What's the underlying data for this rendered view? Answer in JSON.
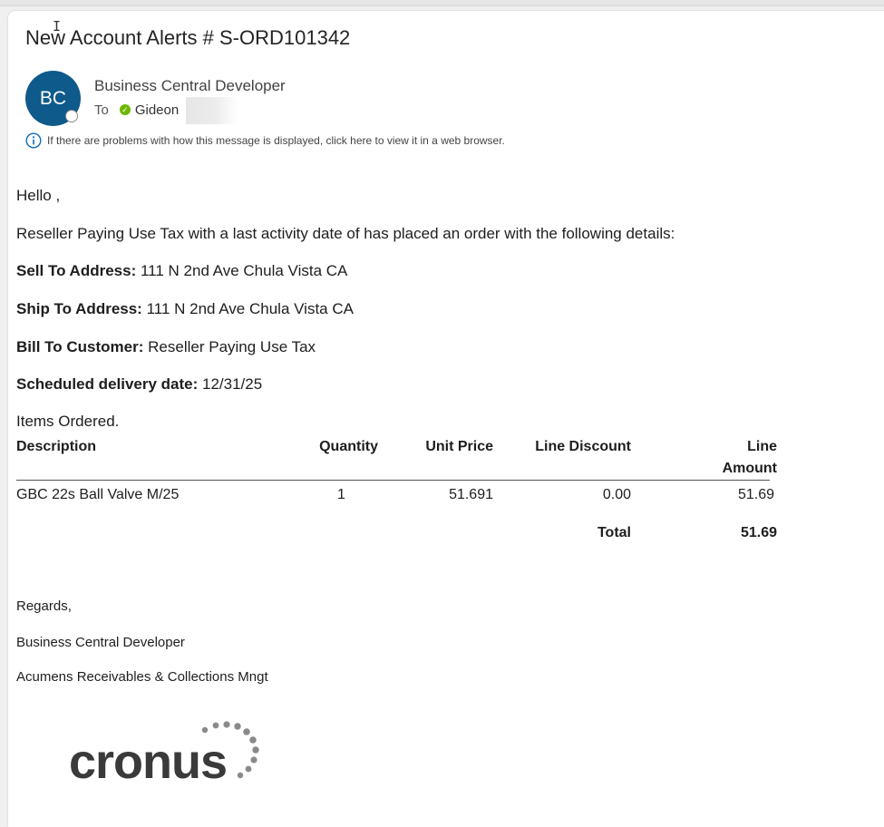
{
  "email": {
    "subject": "New Account Alerts # S-ORD101342",
    "avatar_initials": "BC",
    "sender": "Business Central Developer",
    "to_label": "To",
    "recipient": "Gideon",
    "info_message": "If there are problems with how this message is displayed, click here to view it in a web browser."
  },
  "body": {
    "greeting": "Hello ,",
    "intro": "Reseller Paying Use Tax with a last activity date of  has placed an order with the following details:",
    "sell_to_label": "Sell To Address:",
    "sell_to_value": " 111 N 2nd Ave Chula Vista CA",
    "ship_to_label": "Ship To Address:",
    "ship_to_value": " 111 N 2nd Ave Chula Vista CA",
    "bill_to_label": "Bill To Customer:",
    "bill_to_value": " Reseller Paying Use Tax",
    "delivery_label": "Scheduled delivery date:",
    "delivery_value": " 12/31/25",
    "items_heading": "Items Ordered."
  },
  "table": {
    "headers": {
      "description": "Description",
      "quantity": "Quantity",
      "unit_price": "Unit Price",
      "line_discount": "Line Discount",
      "line_amount_1": "Line",
      "line_amount_2": "Amount"
    },
    "rows": [
      {
        "description": "GBC 22s Ball Valve M/25",
        "quantity": "1",
        "unit_price": "51.691",
        "line_discount": "0.00",
        "line_amount": "51.69"
      }
    ],
    "total_label": "Total",
    "total_value": "51.69"
  },
  "signature": {
    "regards": "Regards,",
    "name": "Business Central Developer",
    "company": "Acumens Receivables & Collections Mngt"
  },
  "logo": {
    "text": "cronus"
  },
  "colors": {
    "avatar_bg": "#0e5a8a",
    "presence_ok": "#6bb700",
    "info_icon": "#0f6cbd",
    "logo_text": "#3a3a3a",
    "logo_dots": "#8a8a8a"
  }
}
